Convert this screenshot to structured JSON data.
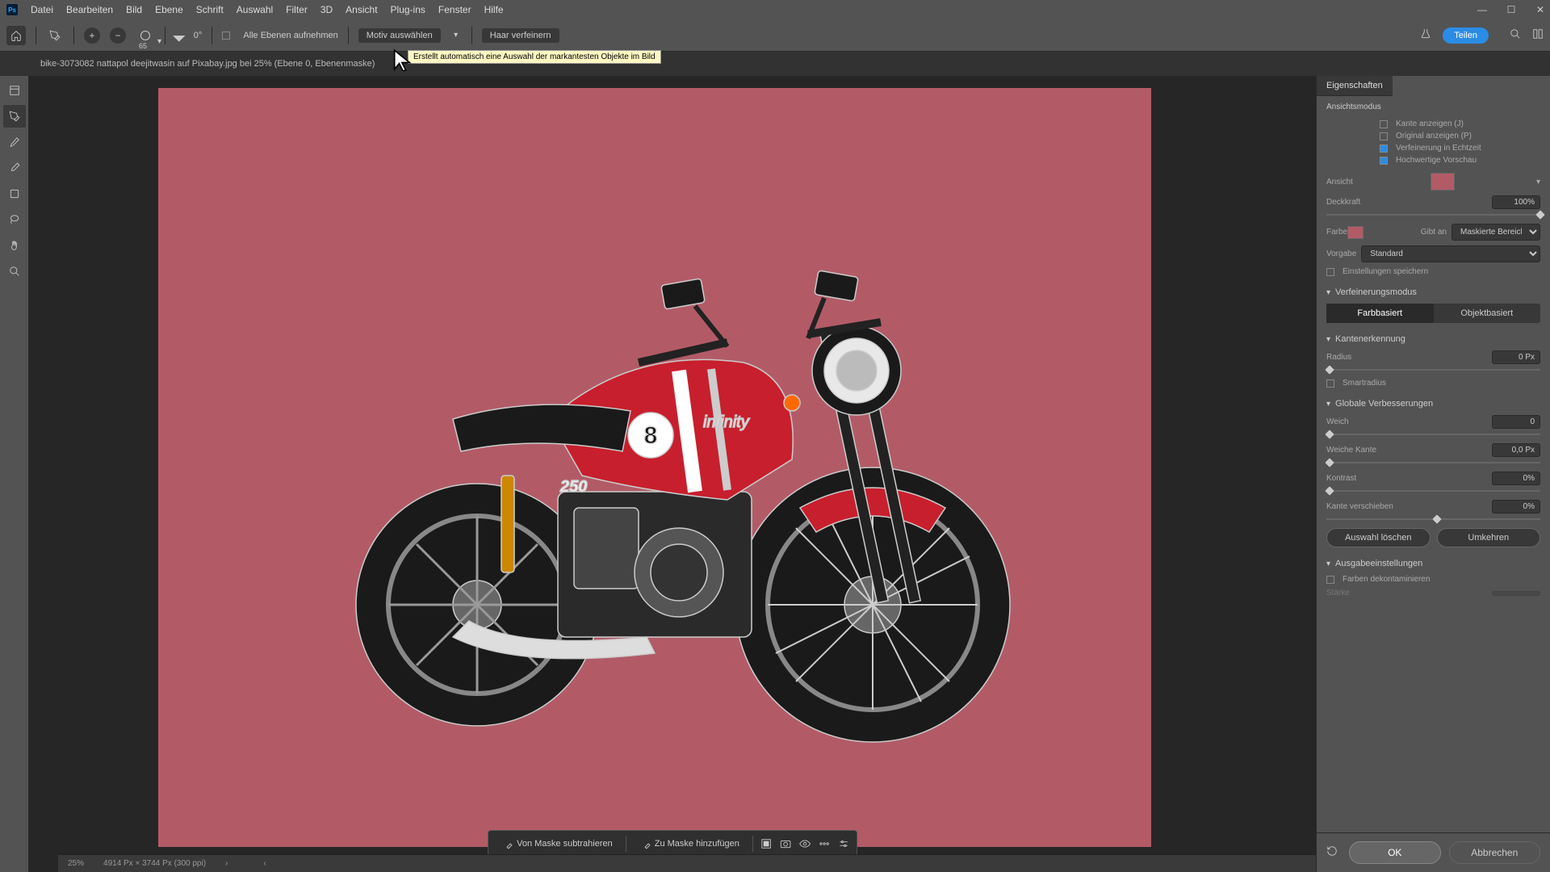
{
  "menubar": {
    "items": [
      "Datei",
      "Bearbeiten",
      "Bild",
      "Ebene",
      "Schrift",
      "Auswahl",
      "Filter",
      "3D",
      "Ansicht",
      "Plug-ins",
      "Fenster",
      "Hilfe"
    ]
  },
  "optionsbar": {
    "brush_size": "65",
    "angle": "0°",
    "all_layers": "Alle Ebenen aufnehmen",
    "select_subject": "Motiv auswählen",
    "refine_hair": "Haar verfeinern",
    "share": "Teilen"
  },
  "tooltip": "Erstellt automatisch eine Auswahl der markantesten Objekte im Bild",
  "document": {
    "tab_title": "bike-3073082 nattapol deejitwasin auf Pixabay.jpg bei 25% (Ebene 0, Ebenenmaske)"
  },
  "float_toolbar": {
    "subtract": "Von Maske subtrahieren",
    "add": "Zu Maske hinzufügen"
  },
  "status": {
    "zoom": "25%",
    "dims": "4914 Px × 3744 Px (300 ppi)"
  },
  "panel": {
    "title": "Eigenschaften",
    "view_mode": "Ansichtsmodus",
    "view_label": "Ansicht",
    "show_edge": "Kante anzeigen (J)",
    "show_original": "Original anzeigen (P)",
    "realtime_refine": "Verfeinerung in Echtzeit",
    "high_quality": "Hochwertige Vorschau",
    "opacity_label": "Deckkraft",
    "opacity_val": "100%",
    "color_label": "Farbe",
    "shows_label": "Gibt an",
    "shows_val": "Maskierte Bereiche",
    "preset_label": "Vorgabe",
    "preset_val": "Standard",
    "remember_settings": "Einstellungen speichern",
    "refine_mode": "Verfeinerungsmodus",
    "color_based": "Farbbasiert",
    "object_based": "Objektbasiert",
    "edge_detection": "Kantenerkennung",
    "radius_label": "Radius",
    "radius_val": "0 Px",
    "smart_radius": "Smartradius",
    "global_refine": "Globale Verbesserungen",
    "smooth_label": "Weich",
    "smooth_val": "0",
    "feather_label": "Weiche Kante",
    "feather_val": "0,0 Px",
    "contrast_label": "Kontrast",
    "contrast_val": "0%",
    "shift_label": "Kante verschieben",
    "shift_val": "0%",
    "clear_sel": "Auswahl löschen",
    "invert": "Umkehren",
    "output_settings": "Ausgabeeinstellungen",
    "decontaminate": "Farben dekontaminieren",
    "amount_label": "Stärke"
  },
  "buttons": {
    "ok": "OK",
    "cancel": "Abbrechen"
  }
}
